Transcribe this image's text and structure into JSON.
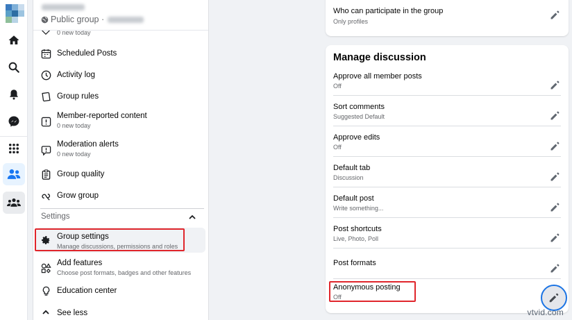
{
  "rail": {
    "items": [
      "logo-icon",
      "home-icon",
      "search-icon",
      "bell-icon",
      "messenger-icon",
      "apps-grid-icon",
      "groups-icon",
      "community-icon"
    ],
    "active_color": "#1877f2"
  },
  "sidebar": {
    "group_type": "Public group ·",
    "items": [
      {
        "label": "",
        "sub": "0 new today",
        "icon": "tag-icon"
      },
      {
        "label": "Scheduled Posts",
        "sub": "",
        "icon": "calendar-icon"
      },
      {
        "label": "Activity log",
        "sub": "",
        "icon": "clock-icon"
      },
      {
        "label": "Group rules",
        "sub": "",
        "icon": "book-icon"
      },
      {
        "label": "Member-reported content",
        "sub": "0 new today",
        "icon": "alert-icon"
      },
      {
        "label": "Moderation alerts",
        "sub": "0 new today",
        "icon": "warning-bubble-icon"
      },
      {
        "label": "Group quality",
        "sub": "",
        "icon": "clipboard-icon"
      },
      {
        "label": "Grow group",
        "sub": "",
        "icon": "growth-icon"
      }
    ],
    "settings_section": "Settings",
    "settings_items": [
      {
        "label": "Group settings",
        "sub": "Manage discussions, permissions and roles",
        "icon": "gear-icon"
      },
      {
        "label": "Add features",
        "sub": "Choose post formats, badges and other features",
        "icon": "shapes-icon"
      },
      {
        "label": "Education center",
        "sub": "",
        "icon": "lightbulb-icon"
      },
      {
        "label": "See less",
        "sub": "",
        "icon": "chevron-up-icon"
      }
    ]
  },
  "participate_card": {
    "label": "Who can participate in the group",
    "value": "Only profiles"
  },
  "manage_discussion": {
    "title": "Manage discussion",
    "rows": [
      {
        "label": "Approve all member posts",
        "value": "Off"
      },
      {
        "label": "Sort comments",
        "value": "Suggested Default"
      },
      {
        "label": "Approve edits",
        "value": "Off"
      },
      {
        "label": "Default tab",
        "value": "Discussion"
      },
      {
        "label": "Default post",
        "value": "Write something..."
      },
      {
        "label": "Post shortcuts",
        "value": "Live, Photo, Poll"
      },
      {
        "label": "Post formats",
        "value": ""
      },
      {
        "label": "Anonymous posting",
        "value": "Off"
      }
    ]
  },
  "watermark": "vtvid.com",
  "colors": {
    "highlight": "#e0252b",
    "accent_blue": "#1877f2",
    "edit_focus": "#1b74e4"
  }
}
